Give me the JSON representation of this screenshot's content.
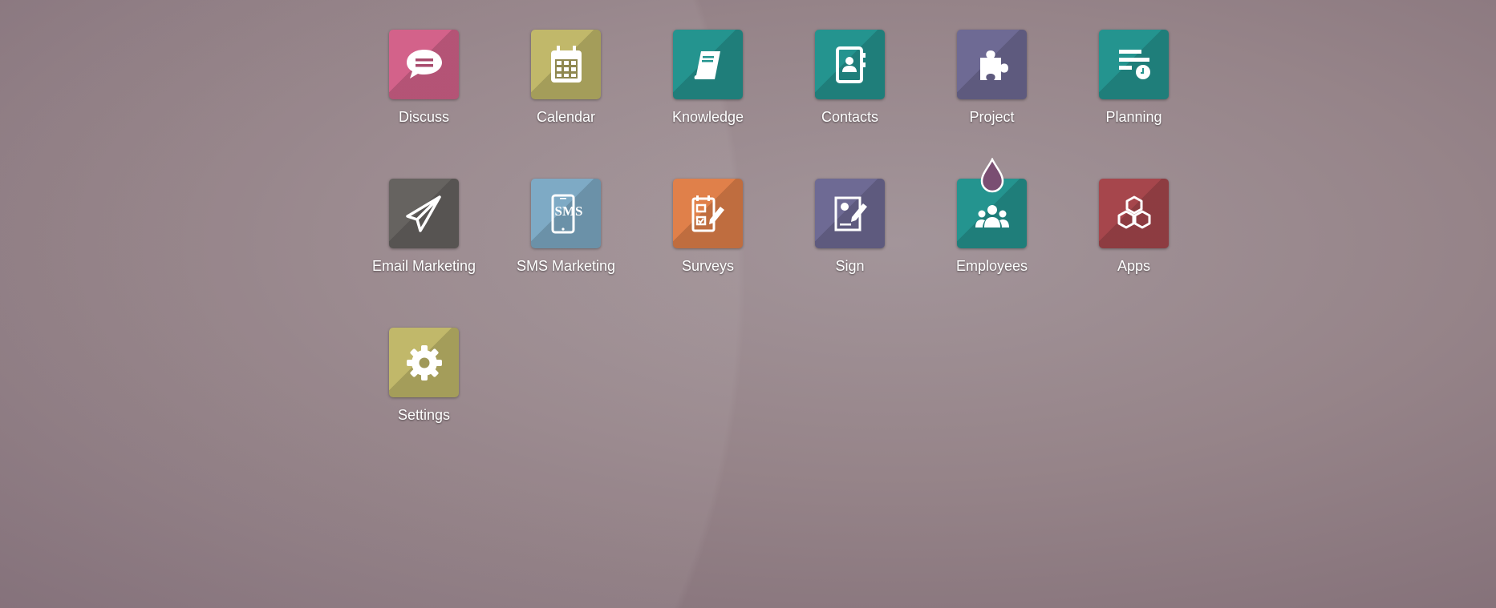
{
  "apps": [
    {
      "label": "Discuss",
      "icon": "chat-bubble-icon",
      "color": "#d3628a"
    },
    {
      "label": "Calendar",
      "icon": "calendar-icon",
      "color": "#c1b86a"
    },
    {
      "label": "Knowledge",
      "icon": "book-icon",
      "color": "#24948f"
    },
    {
      "label": "Contacts",
      "icon": "address-book-icon",
      "color": "#24948f"
    },
    {
      "label": "Project",
      "icon": "puzzle-icon",
      "color": "#6e6a94"
    },
    {
      "label": "Planning",
      "icon": "planning-icon",
      "color": "#24948f"
    },
    {
      "label": "Email Marketing",
      "icon": "paper-plane-icon",
      "color": "#666360"
    },
    {
      "label": "SMS Marketing",
      "icon": "sms-phone-icon",
      "color": "#7eaac5",
      "sms_text": "SMS"
    },
    {
      "label": "Surveys",
      "icon": "survey-icon",
      "color": "#e0804a"
    },
    {
      "label": "Sign",
      "icon": "sign-icon",
      "color": "#6e6a94"
    },
    {
      "label": "Employees",
      "icon": "employees-icon",
      "color": "#24948f"
    },
    {
      "label": "Apps",
      "icon": "cubes-icon",
      "color": "#a6464c"
    },
    {
      "label": "Settings",
      "icon": "gear-icon",
      "color": "#c1b86a"
    }
  ]
}
